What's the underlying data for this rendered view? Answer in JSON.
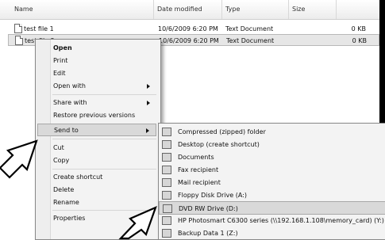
{
  "columns": [
    {
      "label": "Name"
    },
    {
      "label": "Date modified"
    },
    {
      "label": "Type"
    },
    {
      "label": "Size"
    }
  ],
  "files": [
    {
      "name": "test file 1",
      "date": "10/6/2009 6:20 PM",
      "type": "Text Document",
      "size": "0 KB"
    },
    {
      "name": "test file 2",
      "date": "10/6/2009 6:20 PM",
      "type": "Text Document",
      "size": "0 KB"
    }
  ],
  "context_menu": {
    "open": "Open",
    "print": "Print",
    "edit": "Edit",
    "open_with": "Open with",
    "share_with": "Share with",
    "restore": "Restore previous versions",
    "send_to": "Send to",
    "cut": "Cut",
    "copy": "Copy",
    "create_shortcut": "Create shortcut",
    "delete": "Delete",
    "rename": "Rename",
    "properties": "Properties"
  },
  "send_to_menu": {
    "items": [
      {
        "label": "Compressed (zipped) folder",
        "icon": "zip-folder-icon"
      },
      {
        "label": "Desktop (create shortcut)",
        "icon": "desktop-icon"
      },
      {
        "label": "Documents",
        "icon": "documents-icon"
      },
      {
        "label": "Fax recipient",
        "icon": "fax-icon"
      },
      {
        "label": "Mail recipient",
        "icon": "mail-icon"
      },
      {
        "label": "Floppy Disk Drive (A:)",
        "icon": "floppy-icon"
      },
      {
        "label": "DVD RW Drive (D:)",
        "icon": "dvd-icon"
      },
      {
        "label": "HP Photosmart C6300 series (\\\\192.168.1.108\\memory_card) (Y:)",
        "icon": "network-drive-icon"
      },
      {
        "label": "Backup Data 1 (Z:)",
        "icon": "backup-drive-icon"
      }
    ]
  }
}
